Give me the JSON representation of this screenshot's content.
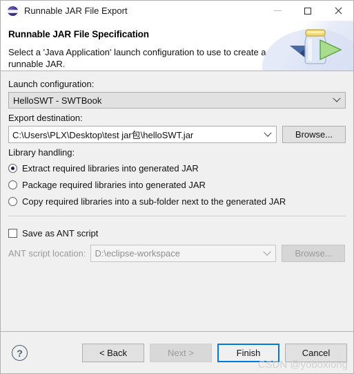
{
  "window": {
    "title": "Runnable JAR File Export",
    "icon": "jar-sphere-icon",
    "controls": {
      "minimize": "–",
      "maximize": "□",
      "close": "✕"
    }
  },
  "header": {
    "title": "Runnable JAR File Specification",
    "description": "Select a 'Java Application' launch configuration to use to create a runnable JAR.",
    "banner_icon": "jar-with-green-arrow-icon"
  },
  "form": {
    "launch_configuration": {
      "label": "Launch configuration:",
      "value": "HelloSWT - SWTBook"
    },
    "export_destination": {
      "label": "Export destination:",
      "value": "C:\\Users\\PLX\\Desktop\\test jar包\\helloSWT.jar",
      "browse_label": "Browse..."
    },
    "library_handling": {
      "label": "Library handling:",
      "options": [
        {
          "label": "Extract required libraries into generated JAR",
          "selected": true
        },
        {
          "label": "Package required libraries into generated JAR",
          "selected": false
        },
        {
          "label": "Copy required libraries into a sub-folder next to the generated JAR",
          "selected": false
        }
      ]
    },
    "ant": {
      "save_checkbox_label": "Save as ANT script",
      "checked": false,
      "location_label": "ANT script location:",
      "location_value": "D:\\eclipse-workspace",
      "browse_label": "Browse..."
    }
  },
  "footer": {
    "help_label": "?",
    "buttons": [
      {
        "label": "< Back",
        "state": "enabled"
      },
      {
        "label": "Next >",
        "state": "disabled"
      },
      {
        "label": "Finish",
        "state": "default"
      },
      {
        "label": "Cancel",
        "state": "enabled"
      }
    ]
  },
  "watermark": "CSDN @yoboxiong",
  "colors": {
    "accent": "#0078d7",
    "dialog_bg": "#f0f0f0",
    "banner_bg": "#ffffff"
  }
}
